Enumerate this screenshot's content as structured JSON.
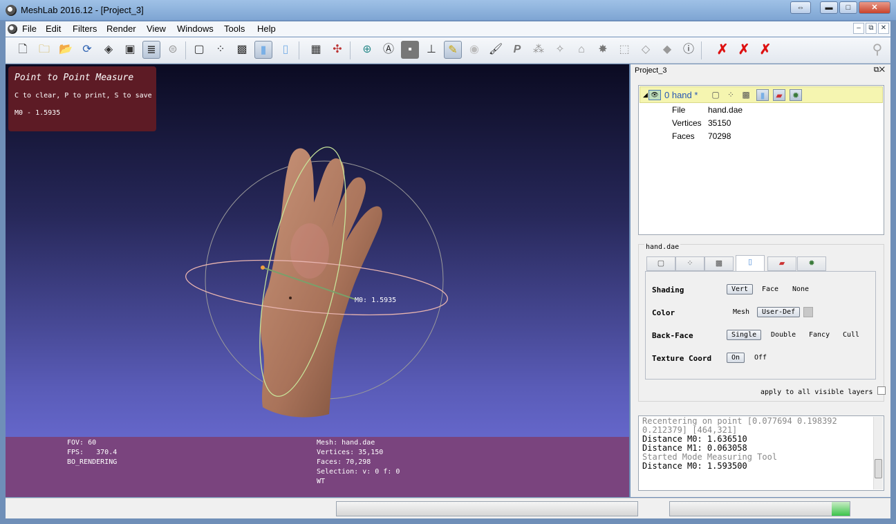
{
  "window": {
    "title": "MeshLab 2016.12 - [Project_3]",
    "restore_glyph": "⇔",
    "minimize_glyph": "▬",
    "maximize_glyph": "□",
    "close_glyph": "✕"
  },
  "menu": {
    "items": [
      "File",
      "Edit",
      "Filters",
      "Render",
      "View",
      "Windows",
      "Tools",
      "Help"
    ],
    "mdi_minimize": "–",
    "mdi_restore": "⧉",
    "mdi_close": "✕"
  },
  "toolbar": {
    "icons": [
      "new-project",
      "open-project",
      "open-mesh",
      "reload",
      "save",
      "snapshot",
      "layers",
      "lock",
      "bbox",
      "points",
      "wireframe",
      "flat",
      "smooth",
      "decorate",
      "axis",
      "sphere-trackball",
      "annotation",
      "texture",
      "point-to-point-measure",
      "clipping",
      "paint-select",
      "brush",
      "p-select",
      "align",
      "manipulate",
      "edit-georef",
      "star",
      "select-vertices",
      "select-faces",
      "select-connected",
      "info",
      "delete-all",
      "delete-face",
      "delete-vertex",
      "search"
    ]
  },
  "measure": {
    "title": "Point to Point Measure",
    "help": "C to clear, P to print, S to save",
    "value": "M0 - 1.5935",
    "label": "M0: 1.5935"
  },
  "info": {
    "fov": "FOV: 60",
    "fps": "FPS:   370.4",
    "rendering": "BO_RENDERING",
    "mesh": "Mesh: hand.dae",
    "vertices": "Vertices: 35,150",
    "faces": "Faces: 70,298",
    "selection": "Selection: v: 0 f: 0",
    "wt": "WT"
  },
  "panel": {
    "title": "Project_3",
    "float_glyph": "⧉✕",
    "layer": {
      "name": "0  hand *",
      "file_label": "File",
      "file": "hand.dae",
      "vertices_label": "Vertices",
      "vertices": "35150",
      "faces_label": "Faces",
      "faces": "70298"
    },
    "render": {
      "group_title": "hand.dae",
      "shading_label": "Shading",
      "shading_opts": [
        "Vert",
        "Face",
        "None"
      ],
      "color_label": "Color",
      "color_opts": [
        "Mesh",
        "User-Def"
      ],
      "backface_label": "Back-Face",
      "backface_opts": [
        "Single",
        "Double",
        "Fancy",
        "Cull"
      ],
      "texcoord_label": "Texture Coord",
      "texcoord_opts": [
        "On",
        "Off"
      ],
      "apply_all": "apply to all visible layers"
    },
    "log": [
      {
        "text": "Recentering on point [0.077694 0.198392",
        "dim": true
      },
      {
        "text": "0.212379] [464,321]",
        "dim": true
      },
      {
        "text": "Distance M0: 1.636510",
        "dim": false
      },
      {
        "text": "Distance M1: 0.063058",
        "dim": false
      },
      {
        "text": "Started Mode Measuring Tool",
        "dim": true
      },
      {
        "text": "Distance M0: 1.593500",
        "dim": false
      }
    ]
  },
  "status": {
    "progress1": 0,
    "progress2": 0.1
  },
  "colors": {
    "measure_box": "#5d1b25",
    "info_bar": "#7a447e",
    "layer_highlight": "#f5f5b0",
    "progress_fill": "#3cc44a"
  }
}
